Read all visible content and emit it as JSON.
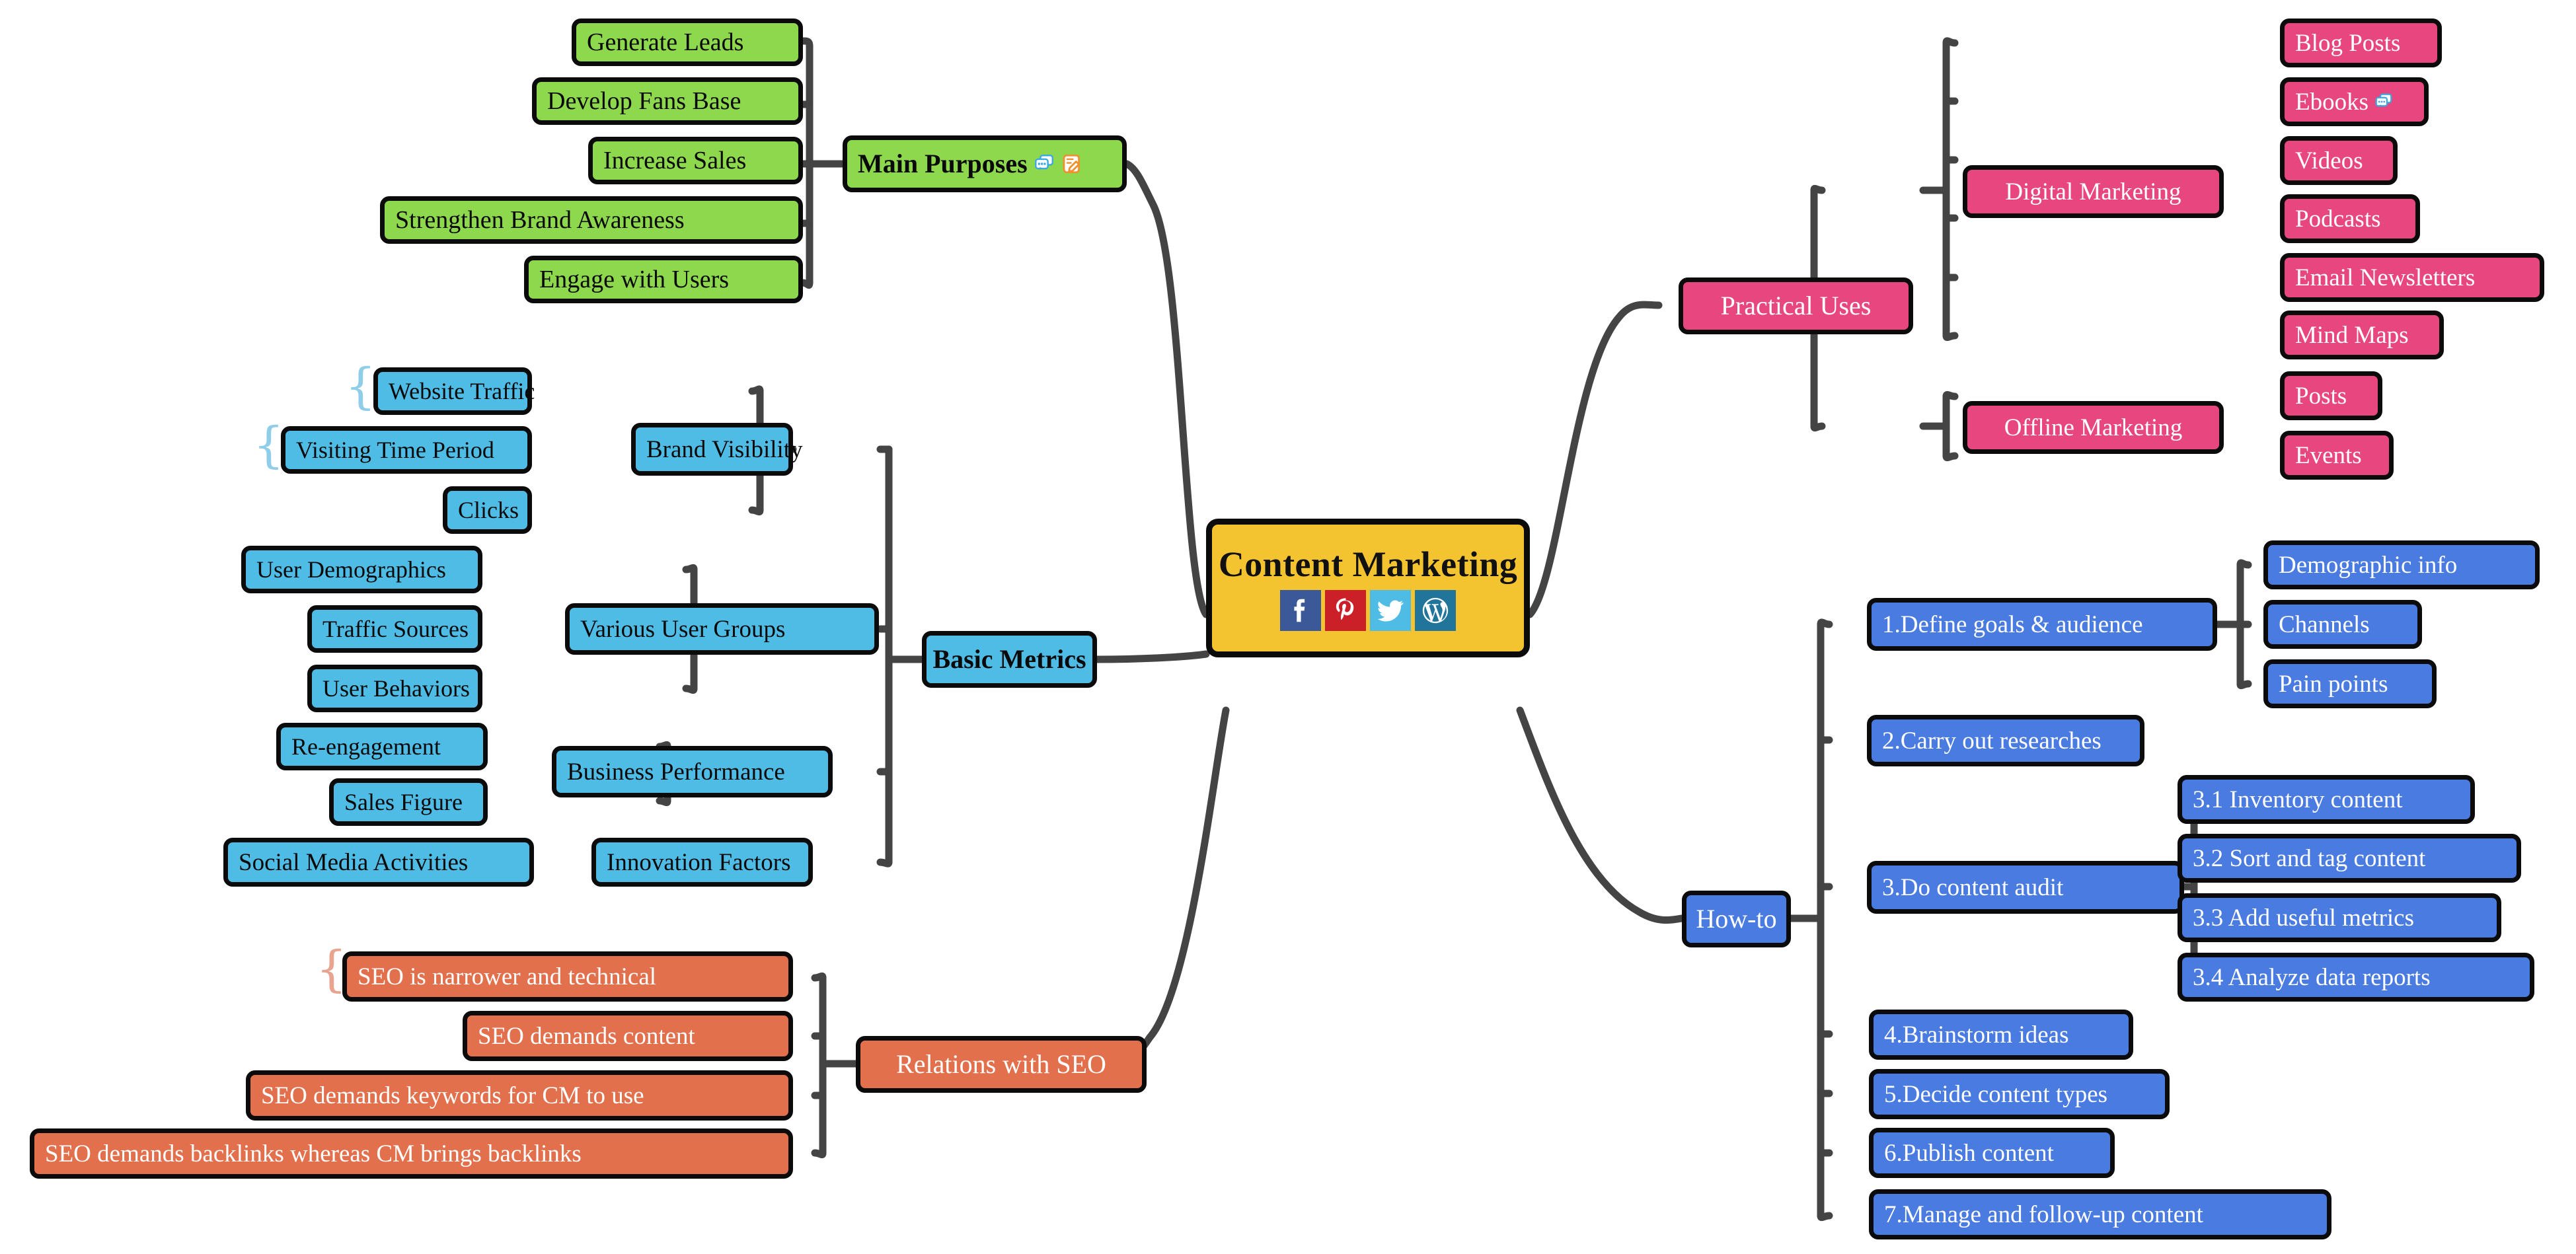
{
  "title": "Content Marketing Mind Map",
  "center": {
    "label": "Content Marketing",
    "color": "#F4C430",
    "social_icons": [
      {
        "name": "facebook-icon",
        "color": "#3B5998"
      },
      {
        "name": "pinterest-icon",
        "color": "#CB2027"
      },
      {
        "name": "twitter-icon",
        "color": "#4FBCE6"
      },
      {
        "name": "wordpress-icon",
        "color": "#21759B"
      }
    ]
  },
  "branches": {
    "main_purposes": {
      "label": "Main Purposes",
      "color": "#8DD84D",
      "icons": [
        "comment-bubble-icon",
        "note-pencil-icon"
      ],
      "children": [
        {
          "label": "Generate Leads"
        },
        {
          "label": "Develop Fans Base"
        },
        {
          "label": "Increase Sales"
        },
        {
          "label": "Strengthen Brand Awareness"
        },
        {
          "label": "Engage with Users"
        }
      ]
    },
    "basic_metrics": {
      "label": "Basic Metrics",
      "color": "#4FBCE6",
      "children": [
        {
          "label": "Brand Visibility",
          "children": [
            {
              "label": "Website Traffic",
              "brace": true
            },
            {
              "label": "Visiting Time Period",
              "brace": true
            },
            {
              "label": "Clicks"
            }
          ]
        },
        {
          "label": "Various User Groups",
          "children": [
            {
              "label": "User Demographics"
            },
            {
              "label": "Traffic Sources"
            },
            {
              "label": "User Behaviors"
            }
          ]
        },
        {
          "label": "Business Performance",
          "children": [
            {
              "label": "Re-engagement"
            },
            {
              "label": "Sales Figure"
            }
          ]
        },
        {
          "label": "Innovation Factors",
          "children": [
            {
              "label": "Social Media Activities"
            }
          ]
        }
      ]
    },
    "relations_with_seo": {
      "label": "Relations with SEO",
      "color": "#E2704D",
      "children": [
        {
          "label": "SEO is narrower and technical",
          "brace": true
        },
        {
          "label": "SEO demands content"
        },
        {
          "label": "SEO demands keywords for CM to use"
        },
        {
          "label": "SEO demands backlinks whereas CM brings backlinks"
        }
      ]
    },
    "practical_uses": {
      "label": "Practical Uses",
      "color": "#E8467E",
      "children": [
        {
          "label": "Digital Marketing",
          "children": [
            {
              "label": "Blog Posts"
            },
            {
              "label": "Ebooks",
              "icons": [
                "comment-bubble-icon"
              ]
            },
            {
              "label": "Videos"
            },
            {
              "label": "Podcasts"
            },
            {
              "label": "Email Newsletters"
            },
            {
              "label": "Mind Maps"
            }
          ]
        },
        {
          "label": "Offline Marketing",
          "children": [
            {
              "label": "Posts"
            },
            {
              "label": "Events"
            }
          ]
        }
      ]
    },
    "how_to": {
      "label": "How-to",
      "color": "#4A7BE0",
      "children": [
        {
          "label": "1.Define goals & audience",
          "children": [
            {
              "label": "Demographic info"
            },
            {
              "label": "Channels"
            },
            {
              "label": "Pain points"
            }
          ]
        },
        {
          "label": "2.Carry out researches"
        },
        {
          "label": "3.Do content audit",
          "children": [
            {
              "label": "3.1 Inventory content"
            },
            {
              "label": "3.2 Sort and tag content"
            },
            {
              "label": "3.3 Add useful metrics"
            },
            {
              "label": "3.4 Analyze data reports"
            }
          ]
        },
        {
          "label": "4.Brainstorm ideas"
        },
        {
          "label": "5.Decide content types"
        },
        {
          "label": "6.Publish content"
        },
        {
          "label": "7.Manage and follow-up content"
        }
      ]
    }
  }
}
